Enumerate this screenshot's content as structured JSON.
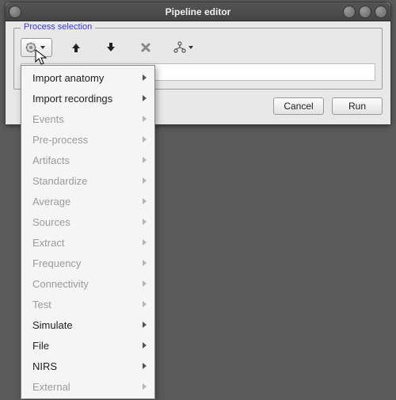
{
  "window": {
    "title": "Pipeline editor"
  },
  "fieldset": {
    "legend": "Process selection"
  },
  "toolbar": {
    "gear_button": "gear",
    "up_button": "up",
    "down_button": "down",
    "delete_button": "delete",
    "tree_button": "tree"
  },
  "buttons": {
    "cancel": "Cancel",
    "run": "Run"
  },
  "menu": {
    "items": [
      {
        "label": "Import anatomy",
        "enabled": true
      },
      {
        "label": "Import recordings",
        "enabled": true
      },
      {
        "label": "Events",
        "enabled": false
      },
      {
        "label": "Pre-process",
        "enabled": false
      },
      {
        "label": "Artifacts",
        "enabled": false
      },
      {
        "label": "Standardize",
        "enabled": false
      },
      {
        "label": "Average",
        "enabled": false
      },
      {
        "label": "Sources",
        "enabled": false
      },
      {
        "label": "Extract",
        "enabled": false
      },
      {
        "label": "Frequency",
        "enabled": false
      },
      {
        "label": "Connectivity",
        "enabled": false
      },
      {
        "label": "Test",
        "enabled": false
      },
      {
        "label": "Simulate",
        "enabled": true
      },
      {
        "label": "File",
        "enabled": true
      },
      {
        "label": "NIRS",
        "enabled": true
      },
      {
        "label": "External",
        "enabled": false
      }
    ]
  }
}
